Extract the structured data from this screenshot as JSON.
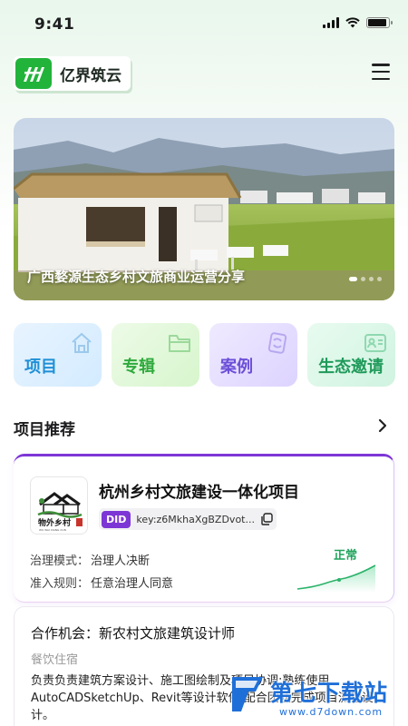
{
  "status_bar": {
    "time": "9:41",
    "battery_level": 0.9
  },
  "header": {
    "app_name": "亿界筑云",
    "menu_icon": "hamburger-menu-icon",
    "brand_color": "#22b33b"
  },
  "banner": {
    "caption": "广西婺源生态乡村文旅商业运营分享",
    "slide_count": 4,
    "active_slide": 1
  },
  "categories": [
    {
      "label": "项目",
      "icon": "house-icon",
      "color": "#1f8fd6"
    },
    {
      "label": "专辑",
      "icon": "folder-icon",
      "color": "#2fa93d"
    },
    {
      "label": "案例",
      "icon": "refresh-document-icon",
      "color": "#6c4fd8"
    },
    {
      "label": "生态邀请",
      "icon": "id-card-icon",
      "color": "#1f9a5a"
    }
  ],
  "section": {
    "title": "项目推荐",
    "arrow_icon": "chevron-right-icon"
  },
  "project": {
    "title": "杭州乡村文旅建设一体化项目",
    "logo_text": "物外乡村",
    "logo_subtext": "WU WAI XIANG CUN",
    "did_label": "DID",
    "did_key": "key:z6MkhaXgBZDvot...",
    "governance_label": "治理模式：",
    "governance_value": "治理人决断",
    "admission_label": "准入规则：",
    "admission_value": "任意治理人同意",
    "status": "正常",
    "accent_color": "#7d36d6"
  },
  "opportunity": {
    "title": "合作机会：新农村文旅建筑设计师",
    "tag": "餐饮住宿",
    "description": "负责负责建筑方案设计、施工图绘制及项目协调;熟练使用AutoCADSketchUp、Revit等设计软件,配合团队完成项目流程设计。"
  },
  "watermark": {
    "text": "第七下载站",
    "url": "www.d7down.com"
  }
}
